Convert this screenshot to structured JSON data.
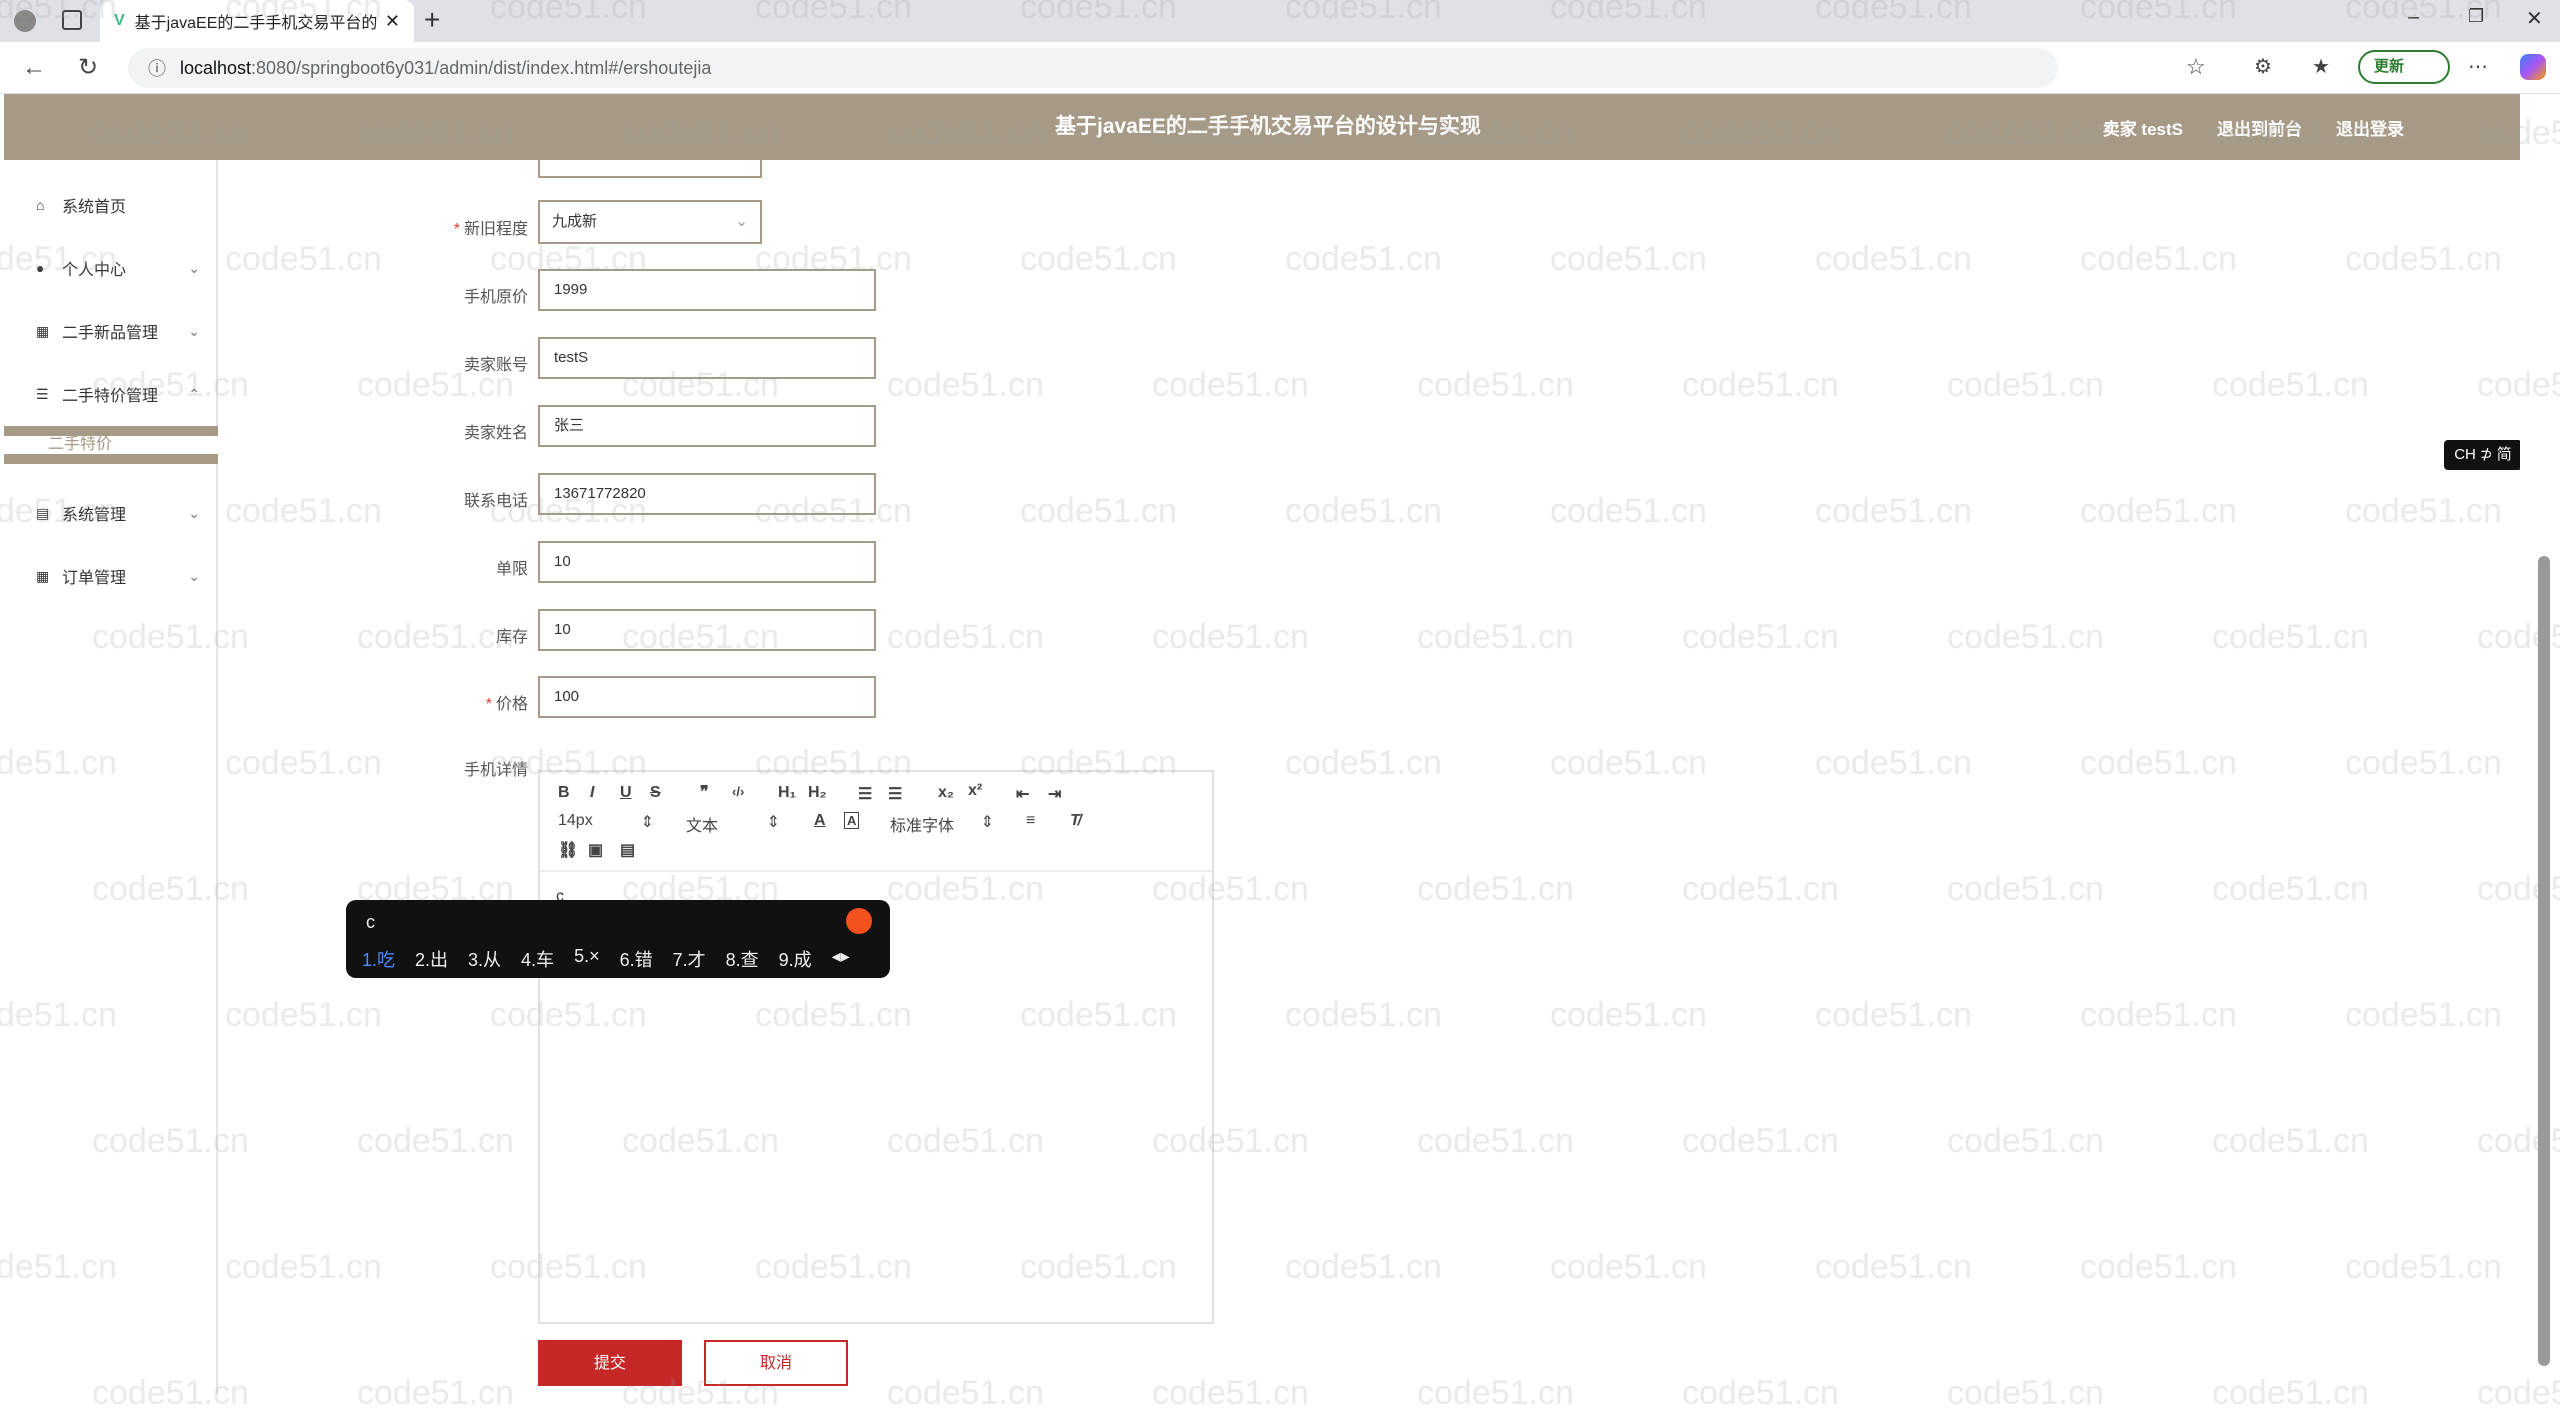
{
  "browser": {
    "tab_title": "基于javaEE的二手手机交易平台的",
    "url_host": "localhost",
    "url_path": ":8080/springboot6y031/admin/dist/index.html#/ershoutejia",
    "update_label": "更新"
  },
  "header": {
    "title": "基于javaEE的二手手机交易平台的设计与实现",
    "user": "卖家 testS",
    "to_front": "退出到前台",
    "logout": "退出登录"
  },
  "sidebar": {
    "items": [
      {
        "label": "系统首页"
      },
      {
        "label": "个人中心"
      },
      {
        "label": "二手新品管理"
      },
      {
        "label": "二手特价管理"
      },
      {
        "label": "系统管理"
      },
      {
        "label": "订单管理"
      }
    ],
    "sub_active": "二手特价"
  },
  "form": {
    "condition_label": "新旧程度",
    "condition_value": "九成新",
    "original_price_label": "手机原价",
    "original_price_value": "1999",
    "seller_account_label": "卖家账号",
    "seller_account_value": "testS",
    "seller_name_label": "卖家姓名",
    "seller_name_value": "张三",
    "phone_label": "联系电话",
    "phone_value": "13671772820",
    "limit_label": "单限",
    "limit_value": "10",
    "stock_label": "库存",
    "stock_value": "10",
    "price_label": "价格",
    "price_value": "100",
    "details_label": "手机详情",
    "editor_text": "c"
  },
  "toolbar": {
    "font_size": "14px",
    "header_select": "文本",
    "font_family": "标准字体"
  },
  "ime": {
    "composition": "c",
    "candidates": [
      "1.吃",
      "2.出",
      "3.从",
      "4.车",
      "5.×",
      "6.错",
      "7.才",
      "8.查",
      "9.成"
    ]
  },
  "buttons": {
    "submit": "提交",
    "cancel": "取消"
  },
  "lang_indicator": "CH ⊅ 简",
  "watermark": "code51.cn",
  "colors": {
    "header": "#a69a86",
    "primary_button": "#c62828",
    "required": "#e53935"
  }
}
